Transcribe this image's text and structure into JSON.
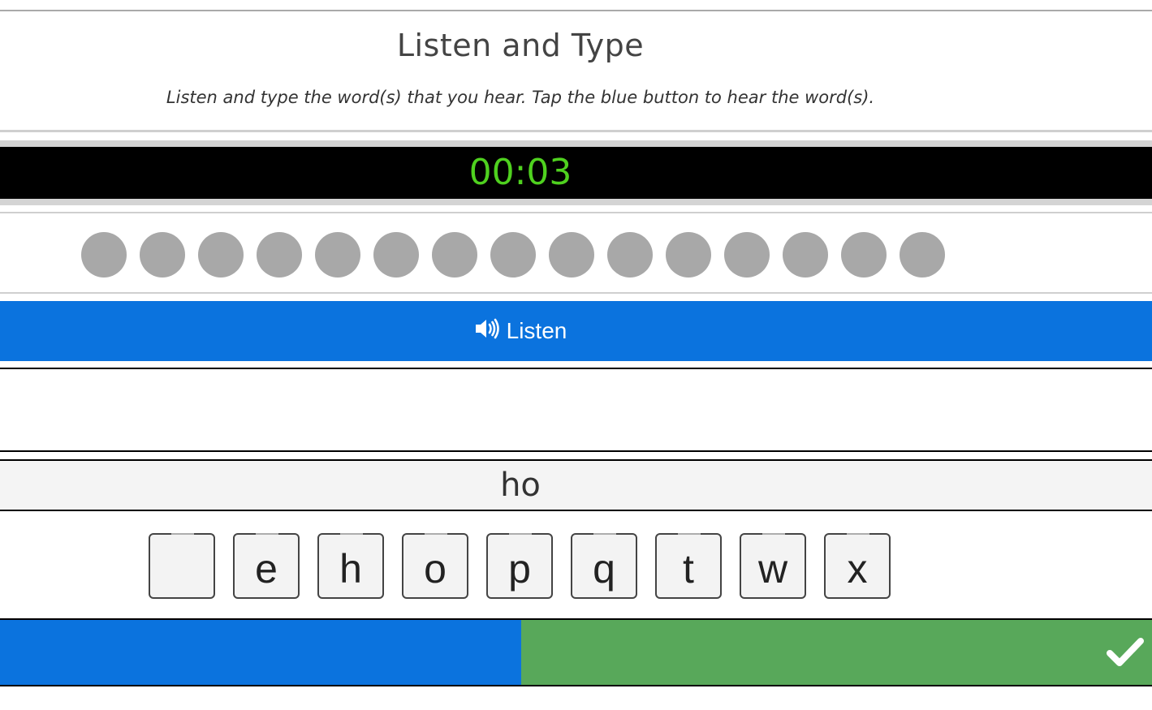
{
  "header": {
    "title": "Listen and Type",
    "instructions": "Listen and type the word(s) that you hear. Tap the blue button to hear the word(s)."
  },
  "timer": {
    "value": "00:03",
    "color": "#4fd11f"
  },
  "progress_dots": {
    "count": 15,
    "color": "#a8a8a8"
  },
  "listen_button": {
    "label": "Listen",
    "icon": "speaker-volume-icon",
    "color": "#0b73de"
  },
  "answer": {
    "value": "ho"
  },
  "keyboard": {
    "keys": [
      " ",
      "e",
      "h",
      "o",
      "p",
      "q",
      "t",
      "w",
      "x"
    ]
  },
  "bottom_bar": {
    "progress_fraction": 0.45,
    "progress_color": "#0b73de",
    "submit_color": "#58a85a",
    "submit_icon": "checkmark-icon"
  }
}
